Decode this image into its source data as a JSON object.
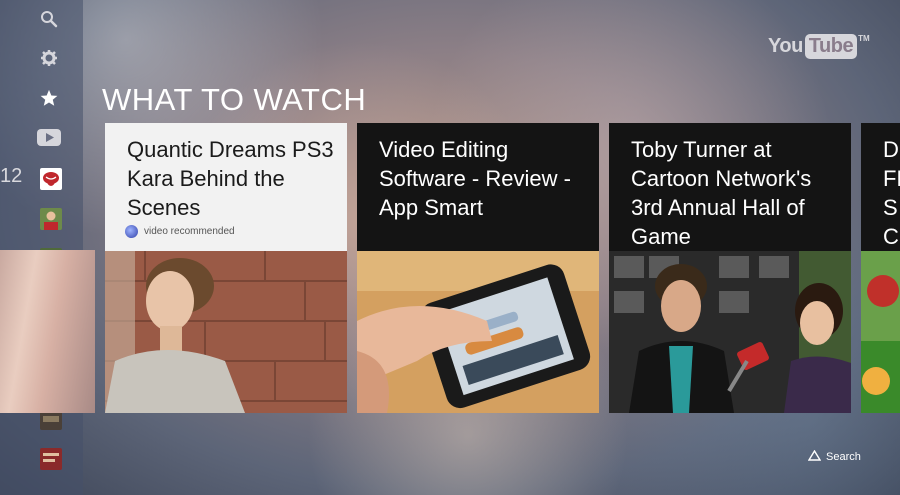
{
  "brand": {
    "you": "You",
    "tube": "Tube",
    "tm": "TM"
  },
  "section": {
    "title": "WHAT TO WATCH"
  },
  "sidebar": {
    "number_text": "12",
    "items": [
      {
        "icon": "search-icon"
      },
      {
        "icon": "gear-icon"
      },
      {
        "icon": "star-icon"
      },
      {
        "icon": "youtube-play-icon"
      }
    ],
    "thumbnails": [
      {
        "name": "rolling-stones-thumb",
        "color": "#c0272d"
      },
      {
        "name": "profile-thumb",
        "color": "#5a6d3a"
      },
      {
        "name": "game-thumb",
        "color": "#4f6a3a"
      },
      {
        "name": "globe-thumb",
        "color": "#4a7fbf"
      },
      {
        "name": "smiley-thumb",
        "color": "#e0a020"
      },
      {
        "name": "cc-thumb",
        "color": "#19b0c8"
      },
      {
        "name": "video-thumb",
        "color": "#4a4038"
      },
      {
        "name": "text-thumb",
        "color": "#8a2a2a"
      }
    ]
  },
  "cards": [
    {
      "title": "Quantic Dreams PS3 Kara Behind the Scenes",
      "subtitle": "video recommended",
      "selected": true
    },
    {
      "title": "Video Editing Software - Review - App Smart",
      "subtitle": "",
      "selected": false
    },
    {
      "title": "Toby Turner at Cartoon Network's 3rd Annual Hall of Game",
      "subtitle": "",
      "selected": false
    }
  ],
  "peek_card": {
    "title": "DI FF SC"
  },
  "hint": {
    "button_icon": "triangle-icon",
    "label": "Search"
  },
  "colors": {
    "card_dark": "#141414",
    "card_selected": "#f2f2f2",
    "accent_red": "#c0272d"
  }
}
